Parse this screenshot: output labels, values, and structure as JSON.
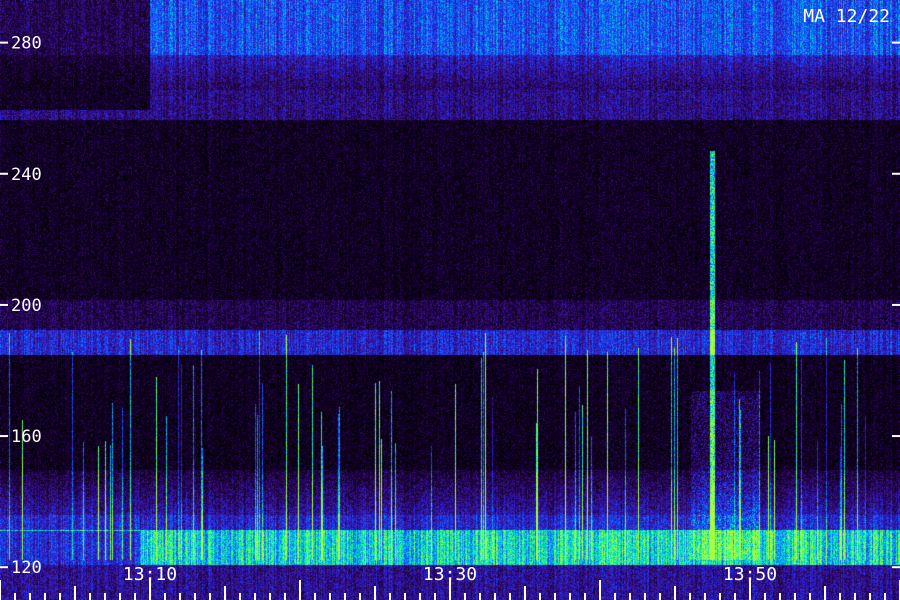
{
  "station_label": "MA 12/22",
  "frequency_axis": {
    "ticks": [
      {
        "value": 280,
        "label": "280"
      },
      {
        "value": 240,
        "label": "240"
      },
      {
        "value": 200,
        "label": "200"
      },
      {
        "value": 160,
        "label": "160"
      },
      {
        "value": 120,
        "label": "120"
      }
    ],
    "range": [
      110,
      293
    ]
  },
  "time_axis": {
    "major_ticks": [
      {
        "label": "13:10"
      },
      {
        "label": "13:30"
      },
      {
        "label": "13:50"
      }
    ]
  },
  "colors": {
    "background": "#000000",
    "low": "#2a0a6a",
    "mid": "#1a3cff",
    "high": "#00e6c8",
    "peak": "#7dff3a"
  },
  "features": [
    {
      "type": "horizontal-band",
      "description_value": 283
    },
    {
      "type": "horizontal-band",
      "description_value": 182
    },
    {
      "type": "horizontal-band",
      "description_value": 113
    },
    {
      "type": "vertical-burst",
      "time_fraction": 0.79
    }
  ]
}
